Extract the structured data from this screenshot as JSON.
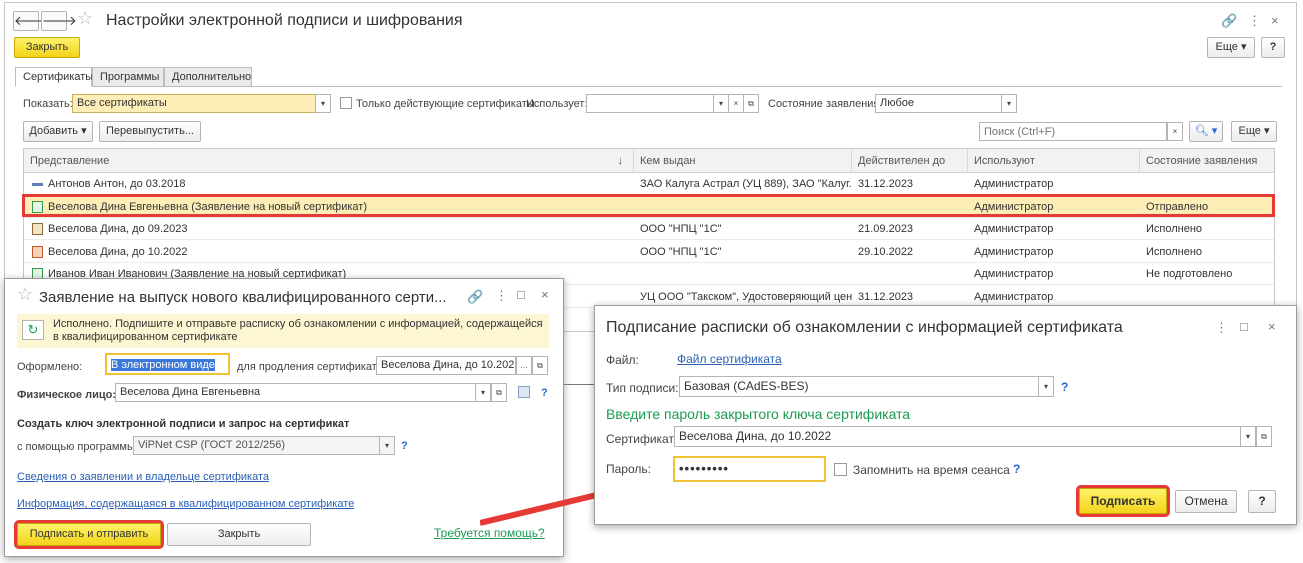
{
  "main": {
    "title": "Настройки электронной подписи и шифрования",
    "close_btn": "Закрыть",
    "more_btn": "Еще",
    "help_btn": "?",
    "tabs": [
      "Сертификаты",
      "Программы",
      "Дополнительно"
    ],
    "filters": {
      "show_label": "Показать:",
      "show_value": "Все сертификаты",
      "only_valid_label": "Только действующие сертификаты",
      "used_by_label": "Использует:",
      "used_by_value": "",
      "status_label": "Состояние заявления:",
      "status_value": "Любое"
    },
    "toolbar": {
      "add": "Добавить",
      "reissue": "Перевыпустить...",
      "search_placeholder": "Поиск (Ctrl+F)",
      "more": "Еще"
    },
    "columns": [
      "Представление",
      "Кем выдан",
      "Действителен до",
      "Используют",
      "Состояние заявления"
    ],
    "rows": [
      {
        "name": "Антонов Антон, до 03.2018",
        "issuer": "ЗАО Калуга Астрал (УЦ 889), ЗАО \"Калуг...",
        "valid": "31.12.2023",
        "users": "Администратор",
        "status": "",
        "icon": "dash"
      },
      {
        "name": "Веселова Дина Евгеньевна (Заявление на новый сертификат)",
        "issuer": "",
        "valid": "",
        "users": "Администратор",
        "status": "Отправлено",
        "icon": "doc-green"
      },
      {
        "name": "Веселова Дина, до 09.2023",
        "issuer": "ООО \"НПЦ \"1С\"",
        "valid": "21.09.2023",
        "users": "Администратор",
        "status": "Исполнено",
        "icon": "cert"
      },
      {
        "name": "Веселова Дина, до 10.2022",
        "issuer": "ООО \"НПЦ \"1С\"",
        "valid": "29.10.2022",
        "users": "Администратор",
        "status": "Исполнено",
        "icon": "cert-warn"
      },
      {
        "name": "Иванов Иван Иванович (Заявление на новый сертификат)",
        "issuer": "",
        "valid": "",
        "users": "Администратор",
        "status": "Не подготовлено",
        "icon": "doc-green"
      },
      {
        "name": "",
        "issuer": "УЦ ООО \"Такском\", Удостоверяющий центр",
        "valid": "31.12.2023",
        "users": "Администратор",
        "status": "",
        "icon": ""
      }
    ]
  },
  "app_dialog": {
    "title": "Заявление на выпуск нового квалифицированного серти...",
    "info": "Исполнено. Подпишите и отправьте расписку об ознакомлении с информацией, содержащейся в квалифицированном сертификате",
    "issued_label": "Оформлено:",
    "issued_value": "В электронном виде",
    "renew_label": "для продления сертификата:",
    "renew_value": "Веселова Дина, до 10.202",
    "person_label": "Физическое лицо:",
    "person_value": "Веселова Дина Евгеньевна",
    "section_title": "Создать ключ электронной подписи и запрос на сертификат",
    "program_label": "с помощью программы:",
    "program_value": "ViPNet CSP (ГОСТ 2012/256)",
    "link1": "Сведения о заявлении и владельце сертификата",
    "link2": "Информация, содержащаяся в квалифицированном сертификате",
    "sign_send_btn": "Подписать и отправить",
    "close_btn": "Закрыть",
    "help_link": "Требуется помощь?"
  },
  "sign_dialog": {
    "title": "Подписание расписки об ознакомлении с информацией сертификата",
    "file_label": "Файл:",
    "file_link": "Файл сертификата",
    "type_label": "Тип подписи:",
    "type_value": "Базовая (CAdES-BES)",
    "prompt": "Введите пароль закрытого ключа сертификата",
    "cert_label": "Сертификат:",
    "cert_value": "Веселова Дина, до 10.2022",
    "password_label": "Пароль:",
    "password_value": "•••••••••",
    "remember_label": "Запомнить на время сеанса",
    "sign_btn": "Подписать",
    "cancel_btn": "Отмена",
    "help_btn": "?"
  },
  "colors": {
    "highlight_red": "#e53a35",
    "arrow_red": "#e53a35",
    "selected_row": "#fdeeb8",
    "yellow_button": "#f3d31a",
    "prompt_green": "#1c9a52"
  }
}
